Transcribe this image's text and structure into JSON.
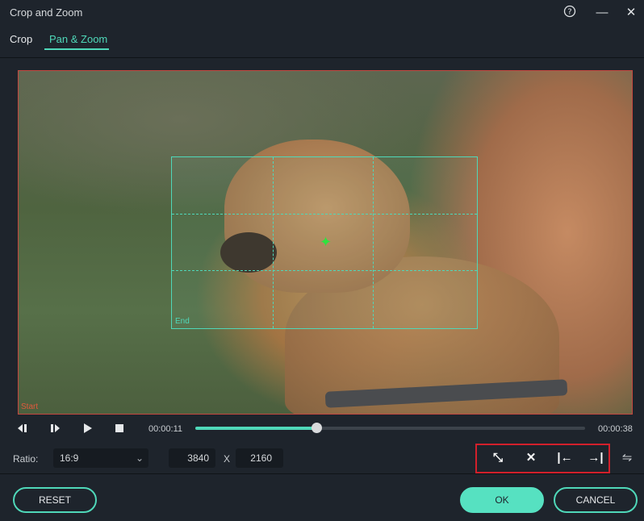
{
  "window": {
    "title": "Crop and Zoom",
    "help_icon": "help-circle-icon",
    "minimize_icon": "minimize-icon",
    "close_icon": "close-icon"
  },
  "tabs": [
    {
      "label": "Crop",
      "active": false
    },
    {
      "label": "Pan & Zoom",
      "active": true
    }
  ],
  "preview": {
    "start_label": "Start",
    "end_label": "End",
    "image": "dog being petted on grass"
  },
  "playback": {
    "current_time": "00:00:11",
    "total_time": "00:00:38",
    "progress_fraction": 0.31,
    "buttons": [
      "previous-frame-icon",
      "next-frame-icon",
      "play-icon",
      "stop-icon"
    ]
  },
  "ratio": {
    "label": "Ratio:",
    "selected": "16:9",
    "width": "3840",
    "separator": "X",
    "height": "2160"
  },
  "tools": [
    {
      "icon": "shrink-icon",
      "glyph": "⤡"
    },
    {
      "icon": "expand-icon",
      "glyph": "✕"
    },
    {
      "icon": "align-start-icon",
      "glyph": "|←"
    },
    {
      "icon": "align-end-icon",
      "glyph": "→|"
    },
    {
      "icon": "swap-icon",
      "glyph": "⇋"
    }
  ],
  "buttons": {
    "reset": "RESET",
    "ok": "OK",
    "cancel": "CANCEL"
  },
  "colors": {
    "accent": "#4fd8b9",
    "highlight": "#d2202b",
    "background": "#1e242c"
  }
}
